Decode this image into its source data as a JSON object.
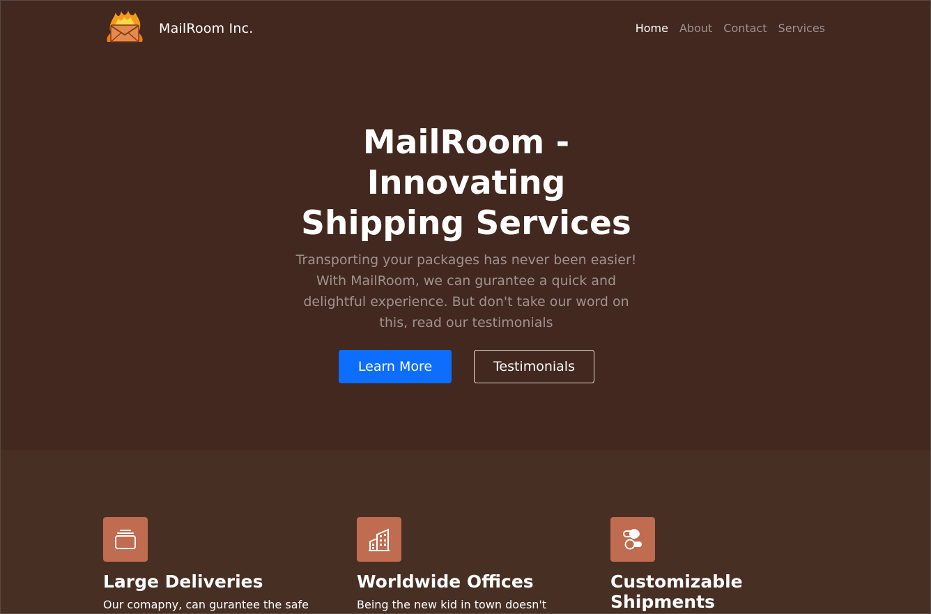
{
  "header": {
    "brand": "MailRoom Inc.",
    "nav": [
      {
        "label": "Home"
      },
      {
        "label": "About"
      },
      {
        "label": "Contact"
      },
      {
        "label": "Services"
      }
    ]
  },
  "hero": {
    "title": "MailRoom - Innovating Shipping Services",
    "text": "Transporting your packages has never been easier! With MailRoom, we can gurantee a quick and delightful experience. But don't take our word on this, read our testimonials",
    "primary_button": "Learn More",
    "secondary_button": "Testimonials"
  },
  "features": [
    {
      "icon": "collection-icon",
      "title": "Large Deliveries",
      "text": "Our comapny, can gurantee the safe"
    },
    {
      "icon": "building-icon",
      "title": "Worldwide Offices",
      "text": "Being the new kid in town doesn't"
    },
    {
      "icon": "toggles-icon",
      "title": "Customizable Shipments",
      "text": ""
    }
  ],
  "colors": {
    "hero_bg": "#42281e",
    "features_bg": "#472f24",
    "primary": "#0d6efd",
    "icon_bg": "#c06c50",
    "muted_text": "#a1938d"
  }
}
